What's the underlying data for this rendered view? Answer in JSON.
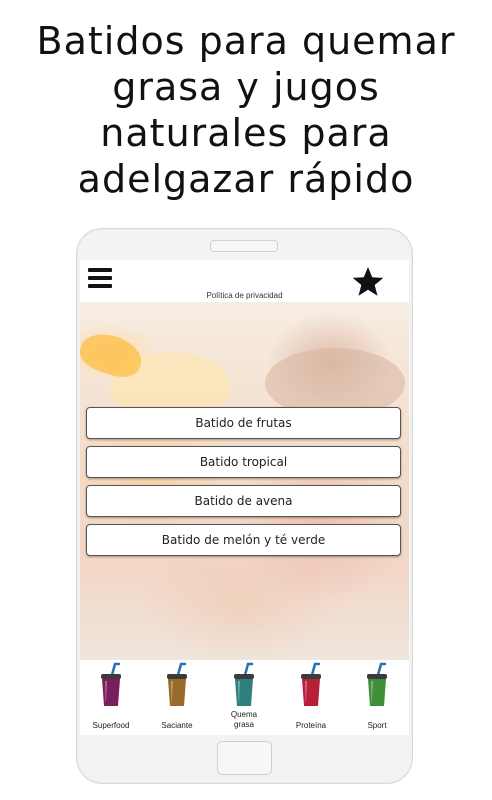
{
  "headline": {
    "line1": "Batidos para quemar",
    "line2": "grasa y jugos",
    "line3": "naturales para",
    "line4": "adelgazar rápido"
  },
  "appbar": {
    "menu_icon": "hamburger-menu-icon",
    "favorite_icon": "star-icon",
    "privacy_link": "Política de privacidad"
  },
  "options": [
    {
      "label": "Batido de frutas"
    },
    {
      "label": "Batido tropical"
    },
    {
      "label": "Batido de avena"
    },
    {
      "label": "Batido de melón y té verde"
    }
  ],
  "bottom_nav": [
    {
      "label": "Superfood",
      "icon": "smoothie-cup-icon",
      "color": "#7a1f5c"
    },
    {
      "label": "Saciante",
      "icon": "smoothie-cup-icon",
      "color": "#9a6a2a"
    },
    {
      "label_line1": "Quema",
      "label_line2": "grasa",
      "icon": "smoothie-cup-icon",
      "color": "#2f7f7a"
    },
    {
      "label": "Proteína",
      "icon": "smoothie-cup-icon",
      "color": "#b8203a"
    },
    {
      "label": "Sport",
      "icon": "smoothie-cup-icon",
      "color": "#3e8e3a"
    }
  ],
  "colors": {
    "lid": "#3b3b3b",
    "straw": "#2a6fb0",
    "button_border": "#555555"
  }
}
